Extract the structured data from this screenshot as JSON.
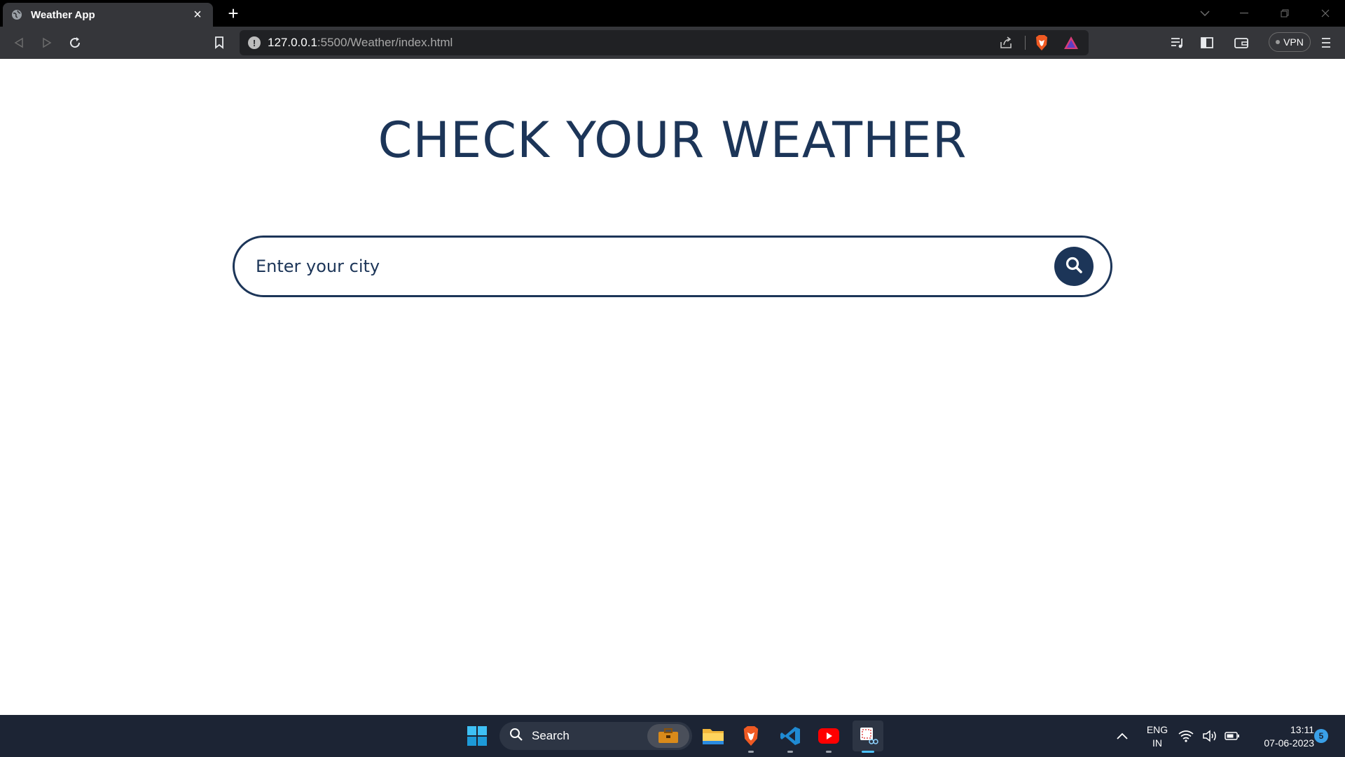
{
  "browser": {
    "tab_title": "Weather App",
    "url_host": "127.0.0.1",
    "url_path": ":5500/Weather/index.html",
    "vpn_label": "VPN"
  },
  "page": {
    "headline": "CHECK YOUR WEATHER",
    "search_placeholder": "Enter your city"
  },
  "taskbar": {
    "search_label": "Search",
    "language_line1": "ENG",
    "language_line2": "IN",
    "time": "13:11",
    "date": "07-06-2023",
    "notification_count": "5"
  },
  "colors": {
    "accent": "#1c3558",
    "taskbar": "#1c2434",
    "browser_chrome": "#35363a"
  }
}
